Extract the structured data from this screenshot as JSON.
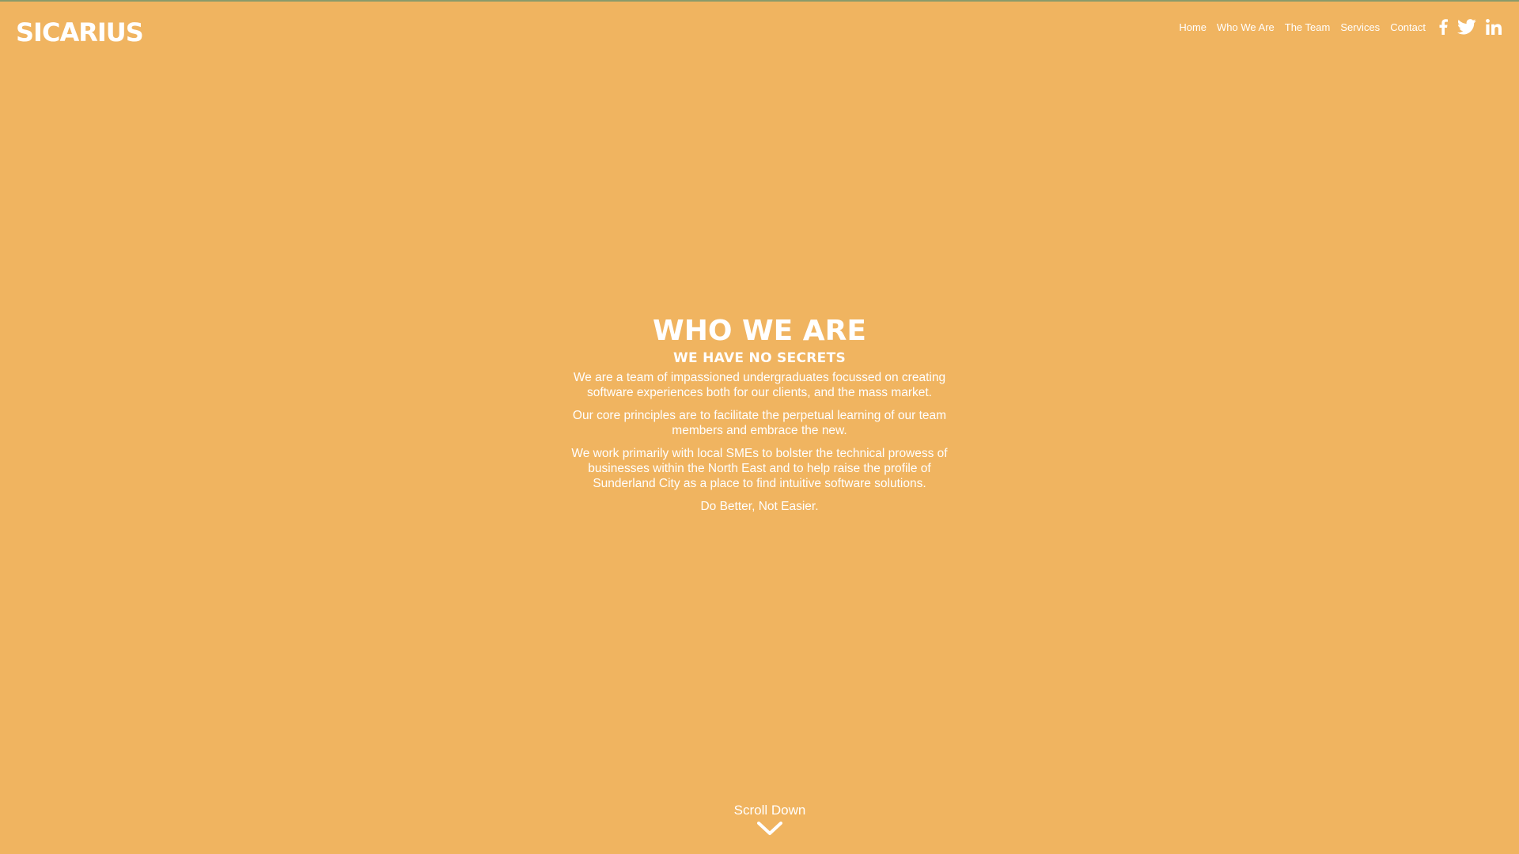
{
  "brand": {
    "logo_text": "SICARIUS"
  },
  "nav": {
    "links": [
      {
        "label": "Home"
      },
      {
        "label": "Who We Are"
      },
      {
        "label": "The Team"
      },
      {
        "label": "Services"
      },
      {
        "label": "Contact"
      }
    ],
    "social": [
      {
        "icon": "facebook-icon"
      },
      {
        "icon": "twitter-icon"
      },
      {
        "icon": "linkedin-icon"
      }
    ]
  },
  "hero": {
    "title": "WHO WE ARE",
    "subtitle": "WE HAVE NO SECRETS",
    "paragraphs": [
      "We are a team of impassioned undergraduates focussed on creating software experiences both for our clients, and the mass market.",
      "Our core principles are to facilitate the perpetual learning of our team members and embrace the new.",
      "We work primarily with local SMEs to bolster the technical prowess of businesses within the North East and to help raise the profile of Sunderland City as a place to find intuitive software solutions.",
      "Do Better, Not Easier."
    ]
  },
  "scroll": {
    "label": "Scroll Down",
    "icon": "chevron-down-icon"
  },
  "colors": {
    "background": "#F0B460",
    "text": "#FFFFFF"
  }
}
